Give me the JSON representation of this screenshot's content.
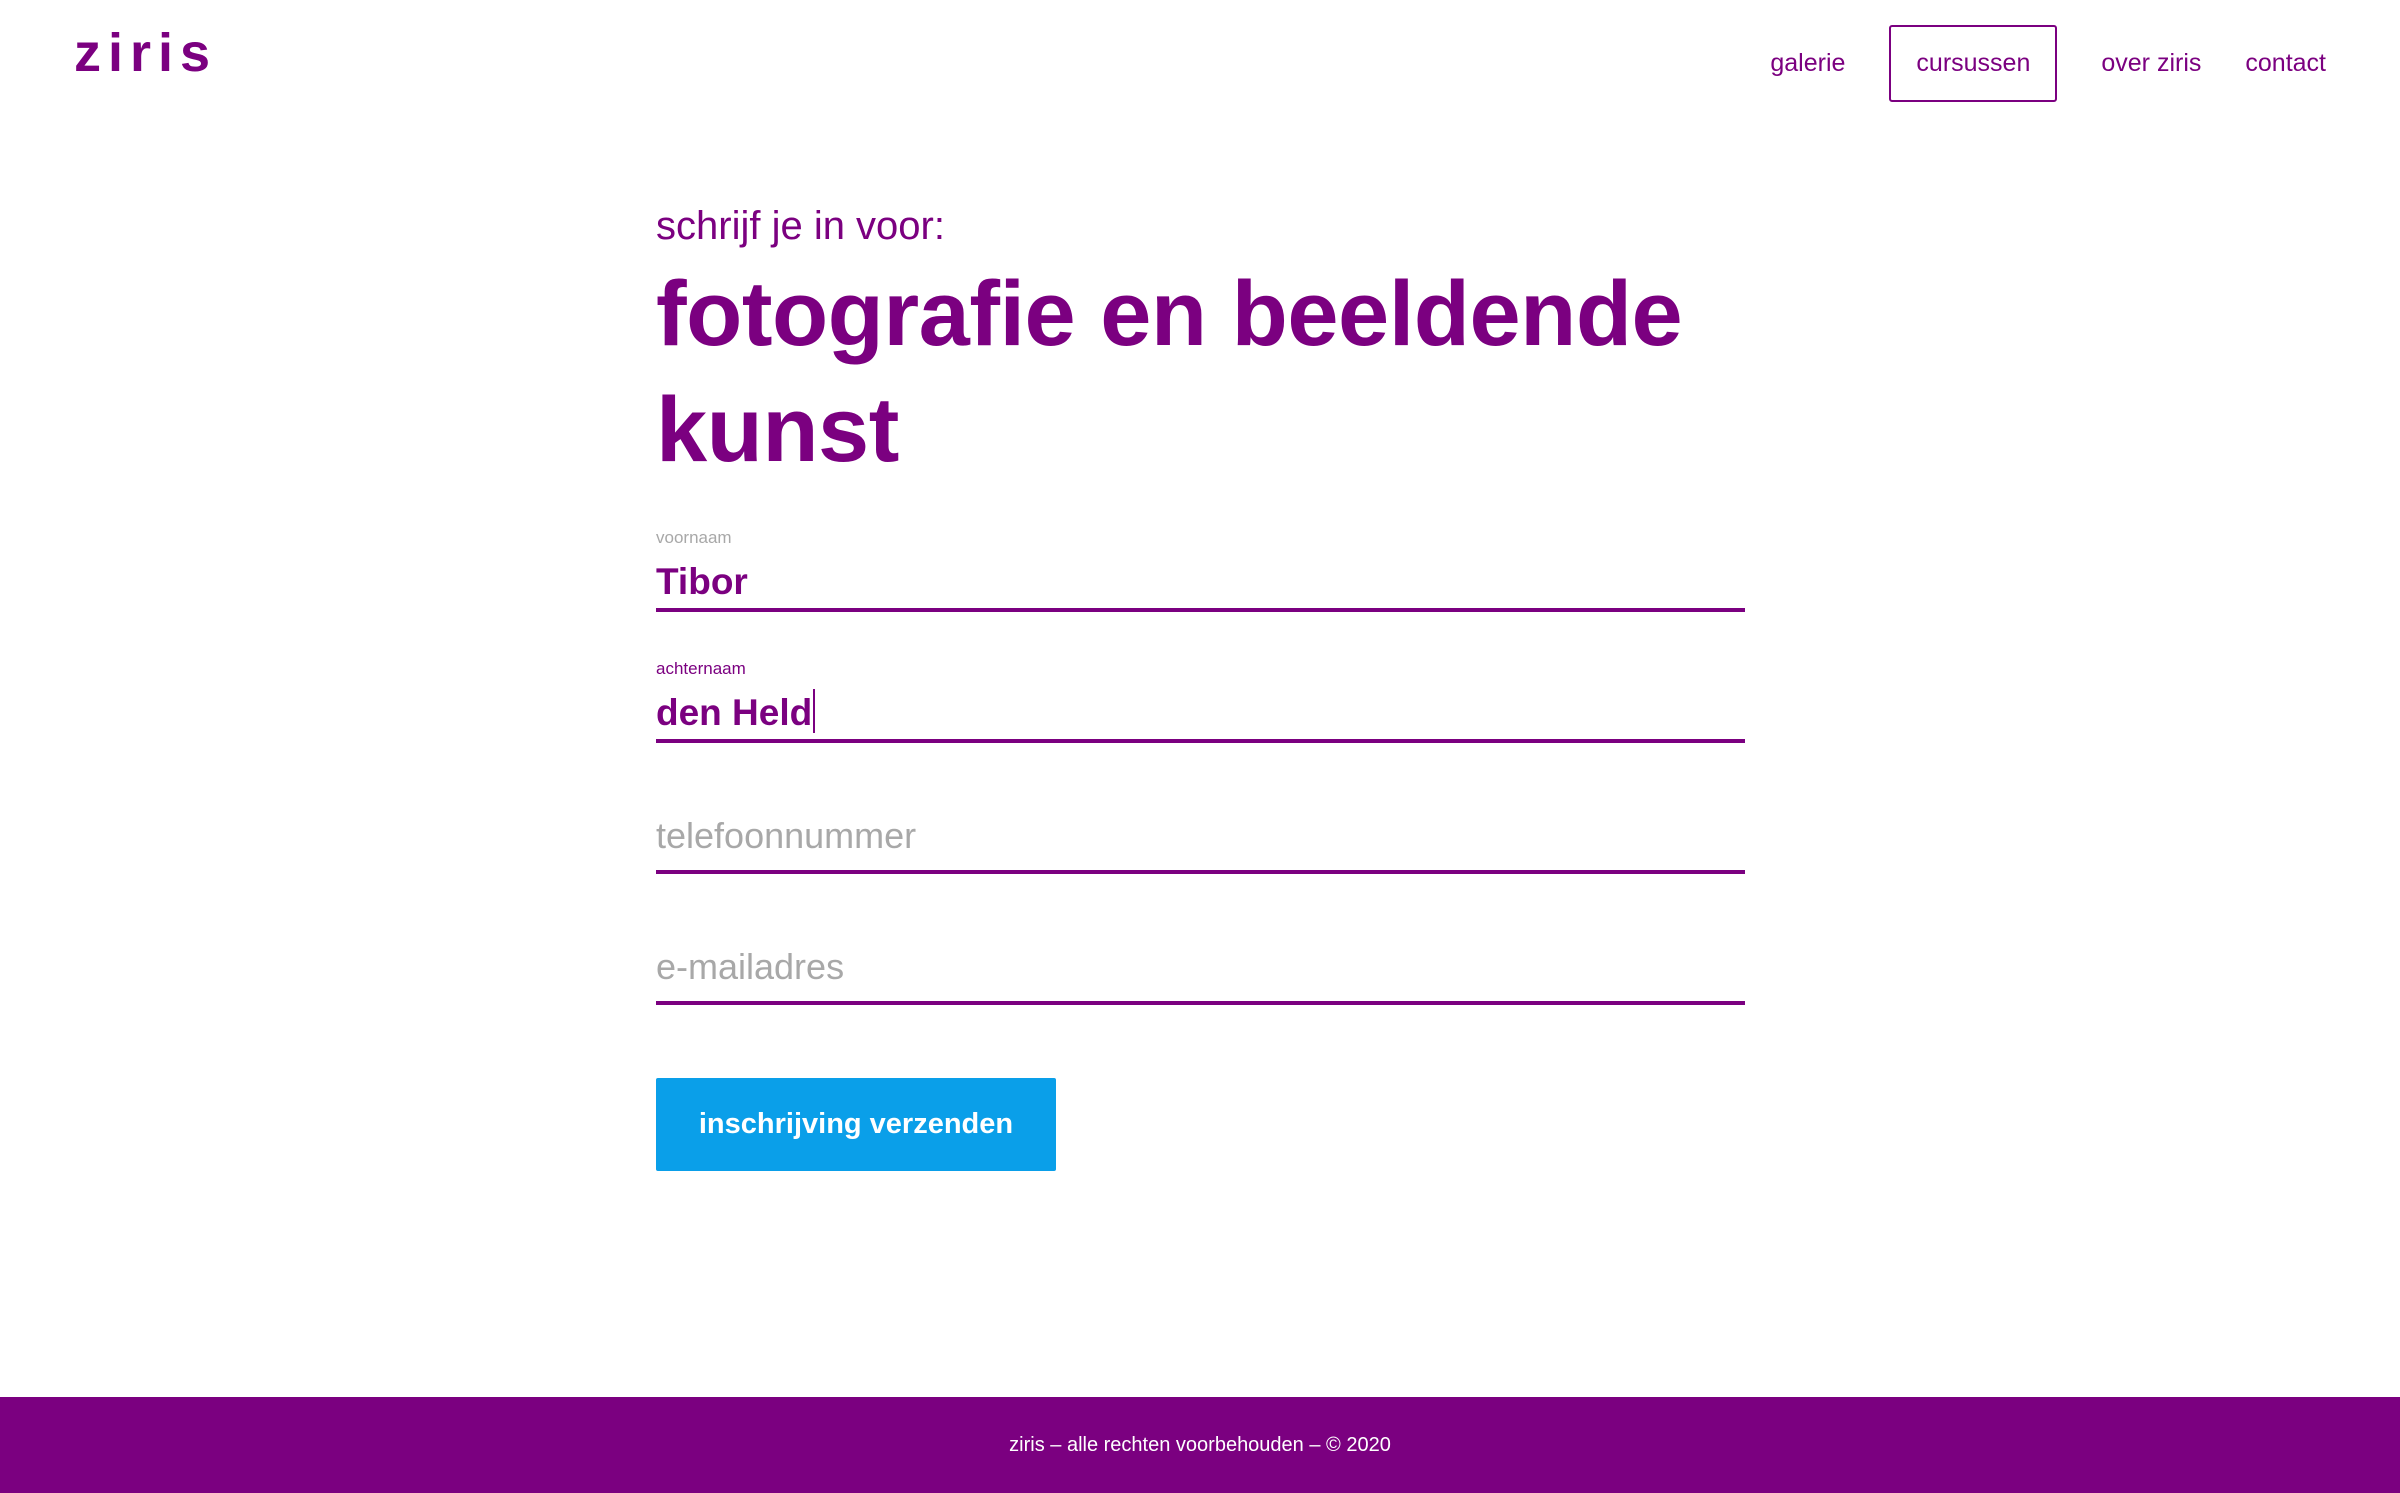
{
  "header": {
    "logo": "ziris",
    "nav": [
      {
        "label": "galerie",
        "active": false
      },
      {
        "label": "cursussen",
        "active": true
      },
      {
        "label": "over ziris",
        "active": false
      },
      {
        "label": "contact",
        "active": false
      }
    ]
  },
  "main": {
    "eyebrow": "schrijf je in voor:",
    "course_title": "fotografie en beeldende kunst",
    "form": {
      "first_name": {
        "label": "voornaam",
        "value": "Tibor"
      },
      "last_name": {
        "label": "achternaam",
        "value": "den Held",
        "focused": true
      },
      "phone": {
        "placeholder": "telefoonnummer",
        "value": ""
      },
      "email": {
        "placeholder": "e-mailadres",
        "value": ""
      },
      "submit_label": "inschrijving verzenden"
    }
  },
  "footer": {
    "text": "ziris – alle rechten voorbehouden – © 2020"
  },
  "colors": {
    "brand": "#7b0080",
    "button": "#0a9fe9",
    "placeholder": "#a8a8a8",
    "background": "#ffffff"
  }
}
